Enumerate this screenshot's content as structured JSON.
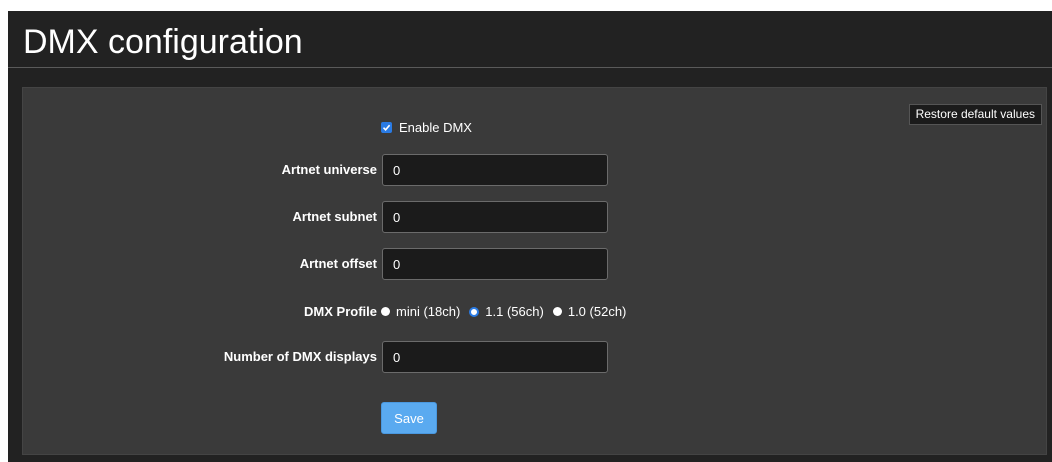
{
  "page": {
    "title": "DMX configuration"
  },
  "panel": {
    "restore_label": "Restore default values",
    "enable": {
      "label": "Enable DMX",
      "checked": true
    },
    "fields": {
      "universe": {
        "label": "Artnet universe",
        "value": "0"
      },
      "subnet": {
        "label": "Artnet subnet",
        "value": "0"
      },
      "offset": {
        "label": "Artnet offset",
        "value": "0"
      },
      "displays": {
        "label": "Number of DMX displays",
        "value": "0"
      }
    },
    "profile": {
      "label": "DMX Profile",
      "options": [
        {
          "label": "mini (18ch)",
          "selected": false
        },
        {
          "label": "1.1 (56ch)",
          "selected": true
        },
        {
          "label": "1.0 (52ch)",
          "selected": false
        }
      ]
    },
    "save_label": "Save"
  },
  "colors": {
    "accent": "#2a7be4",
    "save": "#5aaaf0",
    "panel": "#3a3a3a",
    "background": "#222222"
  }
}
